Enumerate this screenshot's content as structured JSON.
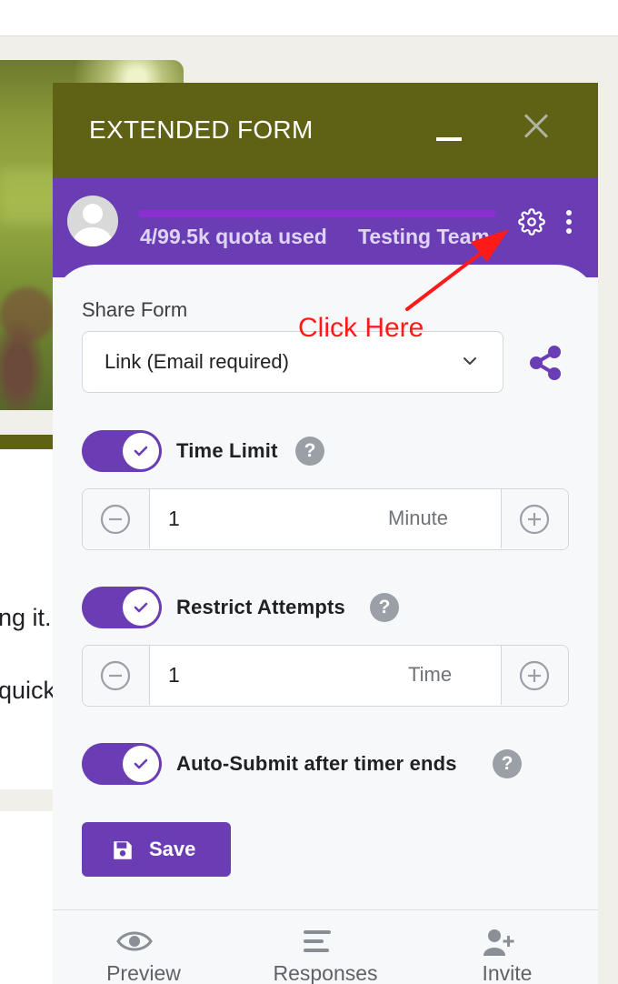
{
  "background": {
    "text_line1": "ng it.",
    "text_line2": "quick"
  },
  "panel": {
    "title": "EXTENDED FORM",
    "header_color": "#5f6214",
    "accent_color": "#6b3db5"
  },
  "user_bar": {
    "quota_used_fraction": 4e-05,
    "quota_text": "4/99.5k quota used",
    "team_name": "Testing Team"
  },
  "share": {
    "label": "Share Form",
    "selected_option": "Link (Email required)"
  },
  "settings": {
    "time_limit": {
      "label": "Time Limit",
      "enabled": true,
      "value": "1",
      "unit": "Minute",
      "help": "?"
    },
    "restrict_attempts": {
      "label": "Restrict Attempts",
      "enabled": true,
      "value": "1",
      "unit": "Time",
      "help": "?"
    },
    "auto_submit": {
      "label": "Auto-Submit after timer ends",
      "enabled": true,
      "help": "?"
    }
  },
  "save_label": "Save",
  "nav": [
    {
      "label": "Preview",
      "icon": "eye-icon"
    },
    {
      "label": "Responses",
      "icon": "list-icon"
    },
    {
      "label": "Invite",
      "icon": "person-add-icon"
    }
  ],
  "annotation": {
    "text": "Click Here",
    "color": "#ff1a1a"
  }
}
